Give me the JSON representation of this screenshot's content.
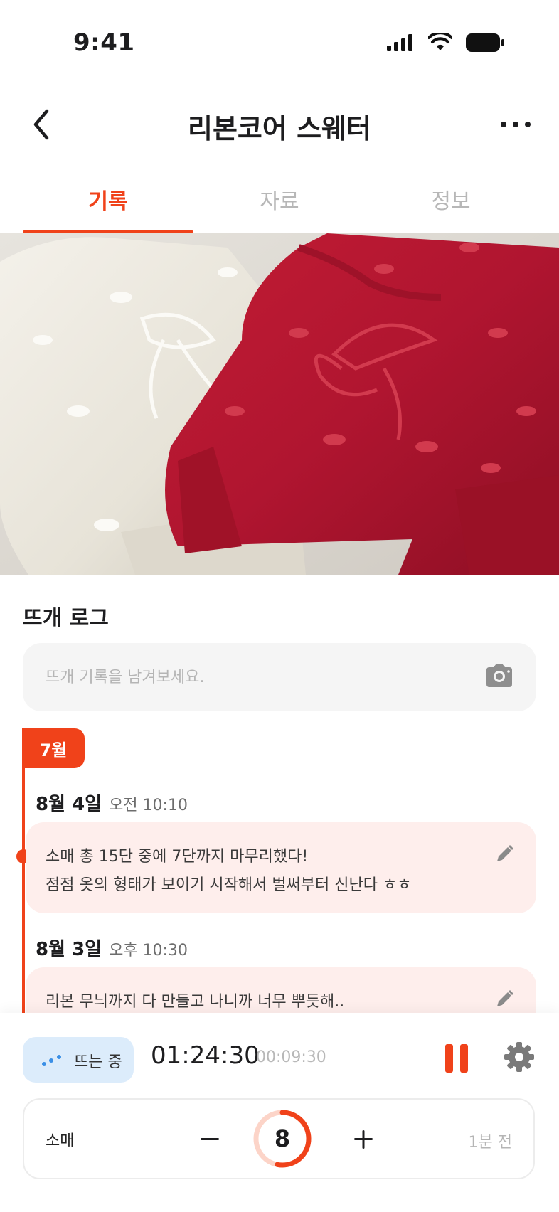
{
  "status_bar": {
    "time": "9:41"
  },
  "header": {
    "title": "리본코어 스웨터"
  },
  "tabs": [
    {
      "label": "기록",
      "active": true
    },
    {
      "label": "자료",
      "active": false
    },
    {
      "label": "정보",
      "active": false
    }
  ],
  "log": {
    "title": "뜨개 로그",
    "input_placeholder": "뜨개 기록을 남겨보세요.",
    "month_badge": "7월",
    "entries": [
      {
        "date": "8월 4일",
        "time": "오전 10:10",
        "lines": [
          "소매 총 15단 중에 7단까지 마무리했다!",
          "점점 옷의 형태가 보이기 시작해서 벌써부터 신난다 ㅎㅎ"
        ]
      },
      {
        "date": "8월 3일",
        "time": "오후 10:30",
        "lines": [
          "리본 무늬까지 다 만들고 나니까 너무 뿌듯해.."
        ]
      }
    ]
  },
  "timer": {
    "status_label": "뜨는 중",
    "main": "01:24:30",
    "sub": "00:09:30"
  },
  "counter": {
    "label": "소매",
    "value": "8",
    "progress": 0.53,
    "updated": "1분 전"
  },
  "colors": {
    "accent": "#f0421a",
    "card_bg": "#feeeec",
    "status_pill_bg": "#dcecfb"
  }
}
